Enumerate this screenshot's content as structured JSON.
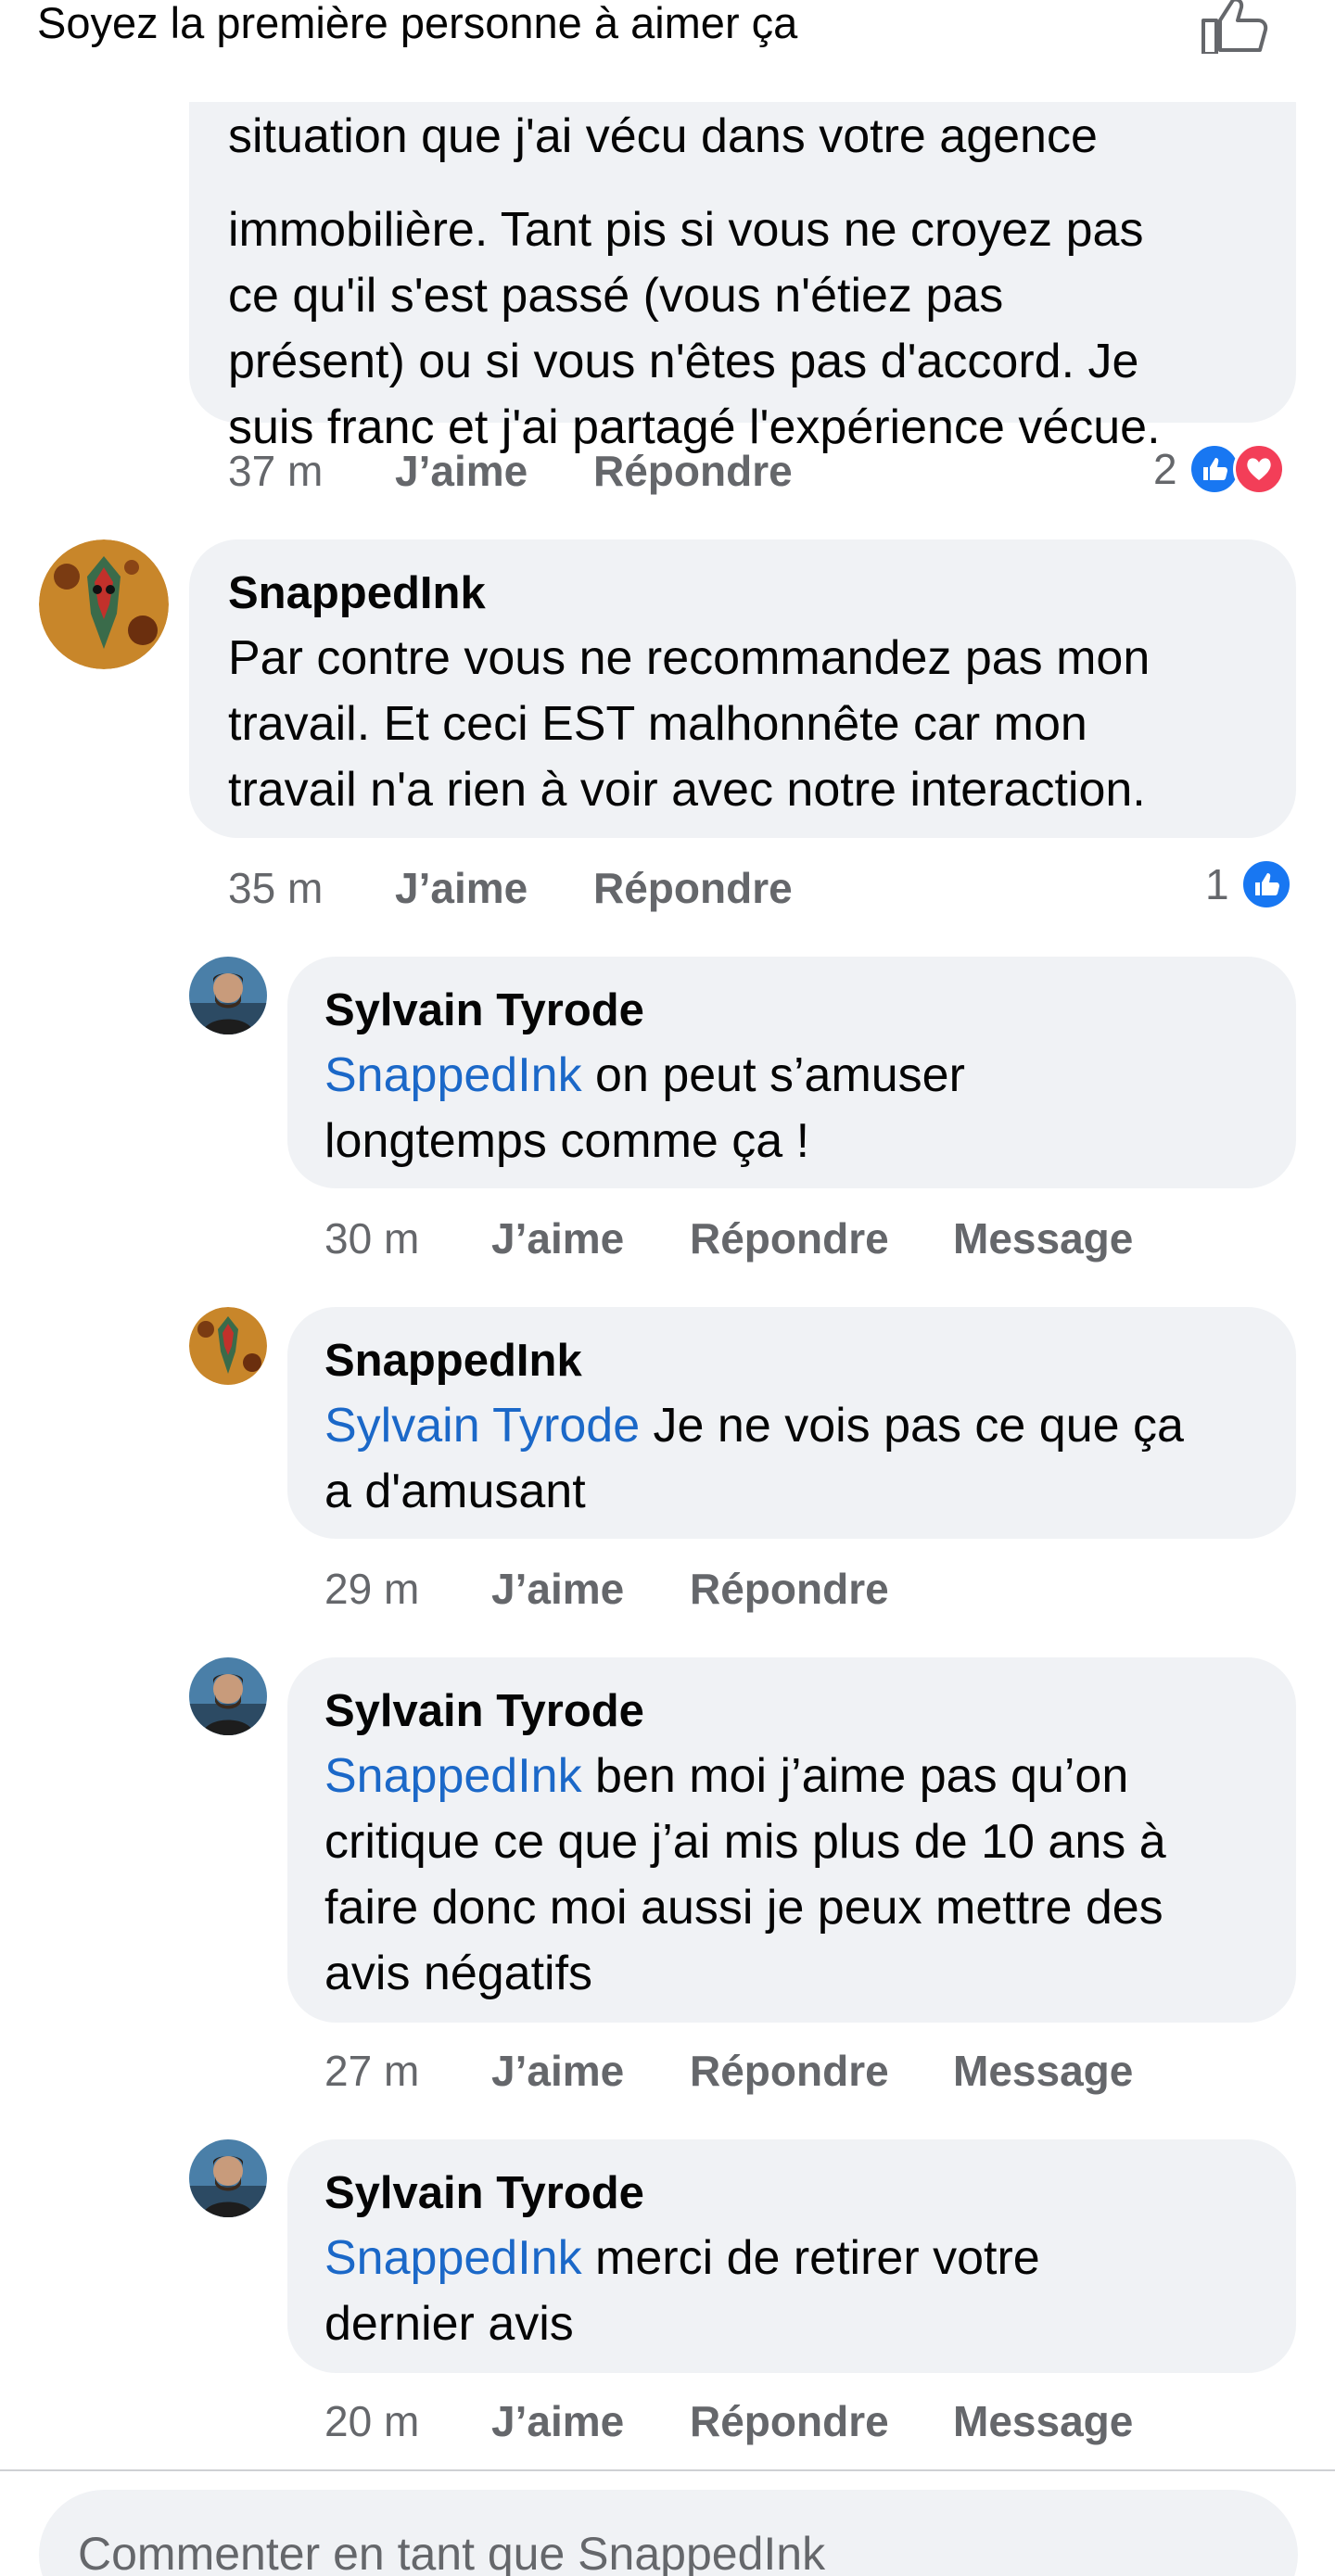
{
  "header": {
    "text": "Soyez la première personne à aimer ça",
    "like_icon": "thumbs-up-outline-icon"
  },
  "comments": [
    {
      "author": "",
      "lines": [
        "situation que j'ai vécu dans votre agence",
        "immobilière. Tant pis si vous ne croyez pas",
        "ce qu'il s'est passé (vous n'étiez pas",
        "présent) ou si vous n'êtes pas d'accord. Je",
        "suis franc et j'ai partagé l'expérience vécue."
      ],
      "time": "37 m",
      "like": "J’aime",
      "reply": "Répondre",
      "reaction_count": "2",
      "reactions": [
        "like-icon",
        "love-icon"
      ]
    },
    {
      "author": "SnappedInk",
      "lines": [
        "Par contre vous ne recommandez pas mon",
        "travail. Et ceci EST malhonnête car mon",
        "travail n'a rien à voir avec notre interaction."
      ],
      "time": "35 m",
      "like": "J’aime",
      "reply": "Répondre",
      "reaction_count": "1",
      "reactions": [
        "like-icon"
      ]
    }
  ],
  "replies": [
    {
      "author": "Sylvain Tyrode",
      "mention": "SnappedInk",
      "first_line": " on peut s’amuser",
      "lines": [
        "longtemps comme ça !"
      ],
      "time": "30 m",
      "like": "J’aime",
      "reply": "Répondre",
      "message": "Message"
    },
    {
      "author": "SnappedInk",
      "mention": "Sylvain Tyrode",
      "first_line": " Je ne vois pas ce que ça",
      "lines": [
        "a d'amusant"
      ],
      "time": "29 m",
      "like": "J’aime",
      "reply": "Répondre",
      "message": ""
    },
    {
      "author": "Sylvain Tyrode",
      "mention": "SnappedInk",
      "first_line": " ben moi j’aime pas qu’on",
      "lines": [
        "critique ce que j’ai mis plus de 10 ans à",
        "faire donc moi aussi je peux mettre des",
        "avis négatifs"
      ],
      "time": "27 m",
      "like": "J’aime",
      "reply": "Répondre",
      "message": "Message"
    },
    {
      "author": "Sylvain Tyrode",
      "mention": "SnappedInk",
      "first_line": " merci de retirer votre",
      "lines": [
        "dernier avis"
      ],
      "time": "20 m",
      "like": "J’aime",
      "reply": "Répondre",
      "message": "Message"
    }
  ],
  "composer": {
    "placeholder": "Commenter en tant que SnappedInk"
  },
  "colors": {
    "mention": "#1b68c8",
    "bubble": "#f0f2f5",
    "meta": "#65676b",
    "like": "#1877f2",
    "love": "#f33e58"
  }
}
